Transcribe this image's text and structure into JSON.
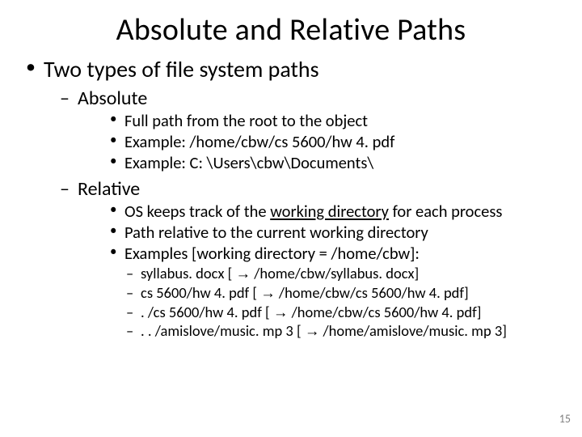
{
  "title": "Absolute and Relative Paths",
  "lvl1": {
    "item1": "Two types of file system paths"
  },
  "lvl2": {
    "absolute": "Absolute",
    "relative": "Relative"
  },
  "absolute": {
    "p1": "Full path from the root to the object",
    "p2": "Example: /home/cbw/cs 5600/hw 4. pdf",
    "p3": "Example: C: \\Users\\cbw\\Documents\\"
  },
  "relative": {
    "p1a": "OS keeps track of the ",
    "p1b": "working directory",
    "p1c": " for each process",
    "p2": "Path relative to the current working directory",
    "p3": "Examples [working directory = /home/cbw]:"
  },
  "examples": {
    "e1a": "syllabus. docx [ ",
    "e1b": " /home/cbw/syllabus. docx]",
    "e2a": "cs 5600/hw 4. pdf [ ",
    "e2b": " /home/cbw/cs 5600/hw 4. pdf]",
    "e3a": ". /cs 5600/hw 4. pdf [ ",
    "e3b": " /home/cbw/cs 5600/hw 4. pdf]",
    "e4a": ". . /amislove/music. mp 3 [ ",
    "e4b": " /home/amislove/music. mp 3]"
  },
  "arrow": "→",
  "page": "15"
}
